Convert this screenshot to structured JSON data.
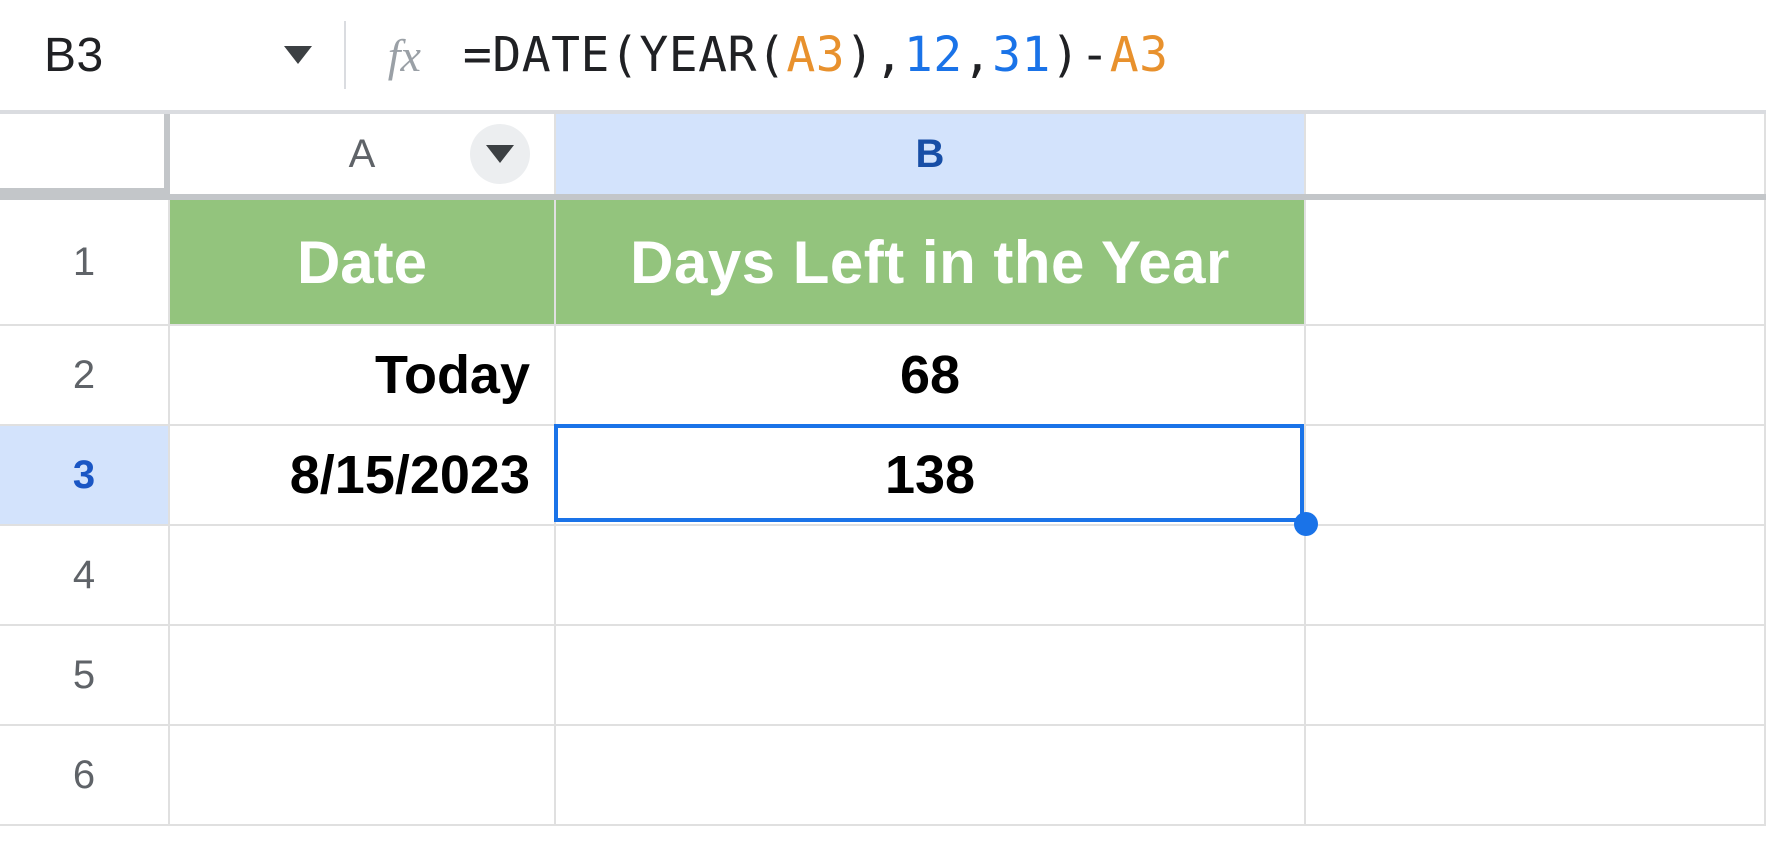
{
  "formula_bar": {
    "cell_ref": "B3",
    "fx": "fx",
    "formula_tokens": [
      {
        "t": "=DATE(YEAR(",
        "cls": "tok-fn"
      },
      {
        "t": "A3",
        "cls": "tok-ref"
      },
      {
        "t": "),",
        "cls": "tok-fn"
      },
      {
        "t": "12",
        "cls": "tok-num"
      },
      {
        "t": ",",
        "cls": "tok-fn"
      },
      {
        "t": "31",
        "cls": "tok-num"
      },
      {
        "t": ")-",
        "cls": "tok-fn"
      },
      {
        "t": "A3",
        "cls": "tok-ref"
      }
    ]
  },
  "grid": {
    "column_headers": [
      "A",
      "B"
    ],
    "selected_column": "B",
    "row_numbers": [
      "1",
      "2",
      "3",
      "4",
      "5",
      "6"
    ],
    "selected_row": "3",
    "table_headers": {
      "A": "Date",
      "B": "Days Left in the Year"
    },
    "rows": [
      {
        "A": "Today",
        "B": "68"
      },
      {
        "A": "8/15/2023",
        "B": "138"
      }
    ],
    "active_cell": "B3"
  }
}
